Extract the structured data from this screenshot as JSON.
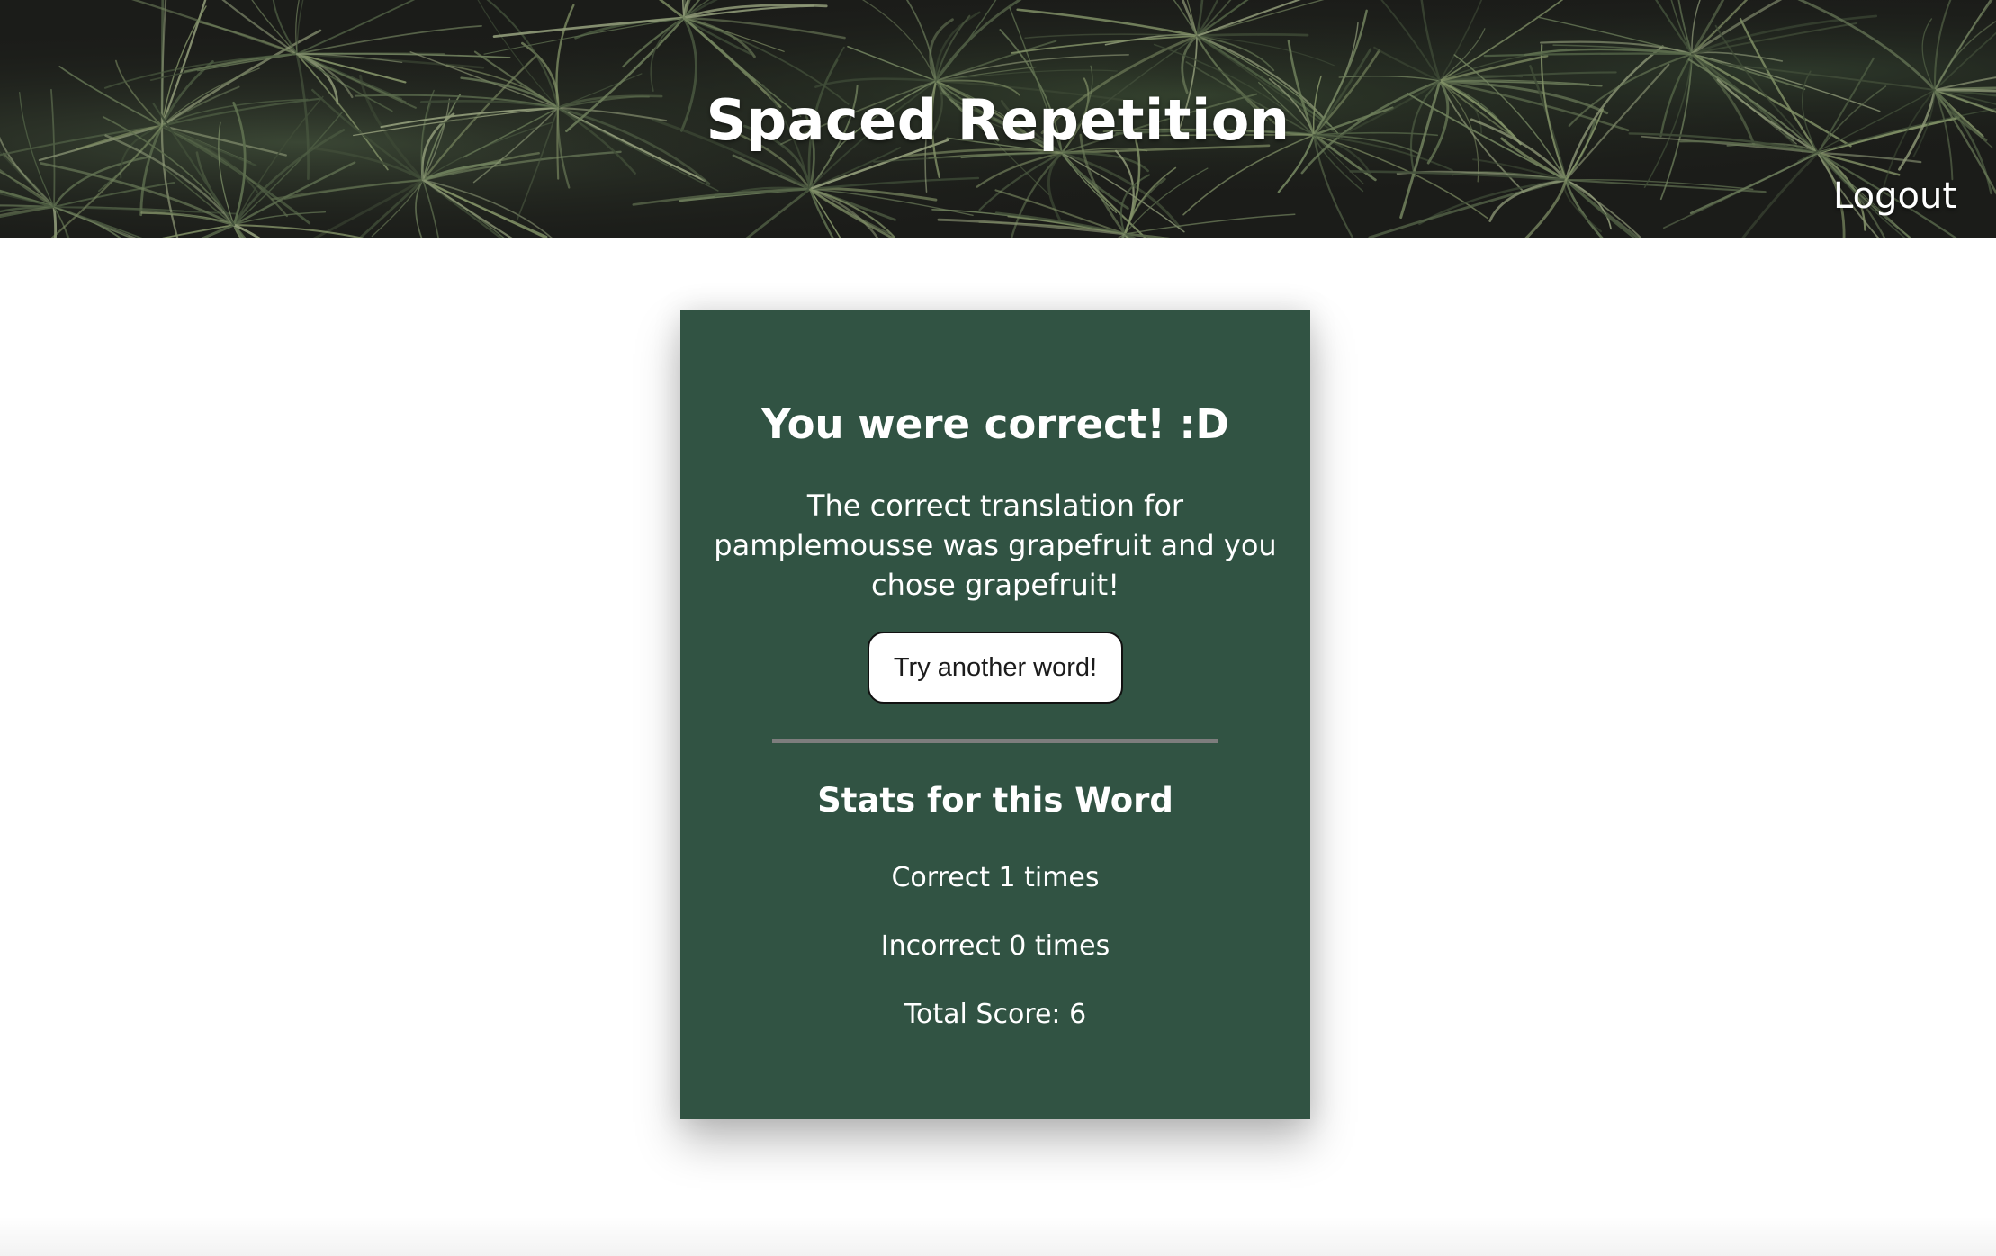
{
  "app": {
    "title": "Spaced Repetition"
  },
  "header": {
    "title": "Spaced Repetition",
    "logout_label": "Logout",
    "background": "pine-needles-photo"
  },
  "result": {
    "heading": "You were correct! :D",
    "feedback": "The correct translation for pamplemousse was grapefruit and you chose grapefruit!",
    "next_button_label": "Try another word!"
  },
  "stats": {
    "heading": "Stats for this Word",
    "correct_text": "Correct 1 times",
    "incorrect_text": "Incorrect 0 times",
    "total_score_text": "Total Score: 6"
  },
  "colors": {
    "card_background": "#315343",
    "header_background": "#1c1c1a",
    "text": "#ffffff",
    "divider": "#7d7d7d",
    "button_background": "#ffffff"
  }
}
